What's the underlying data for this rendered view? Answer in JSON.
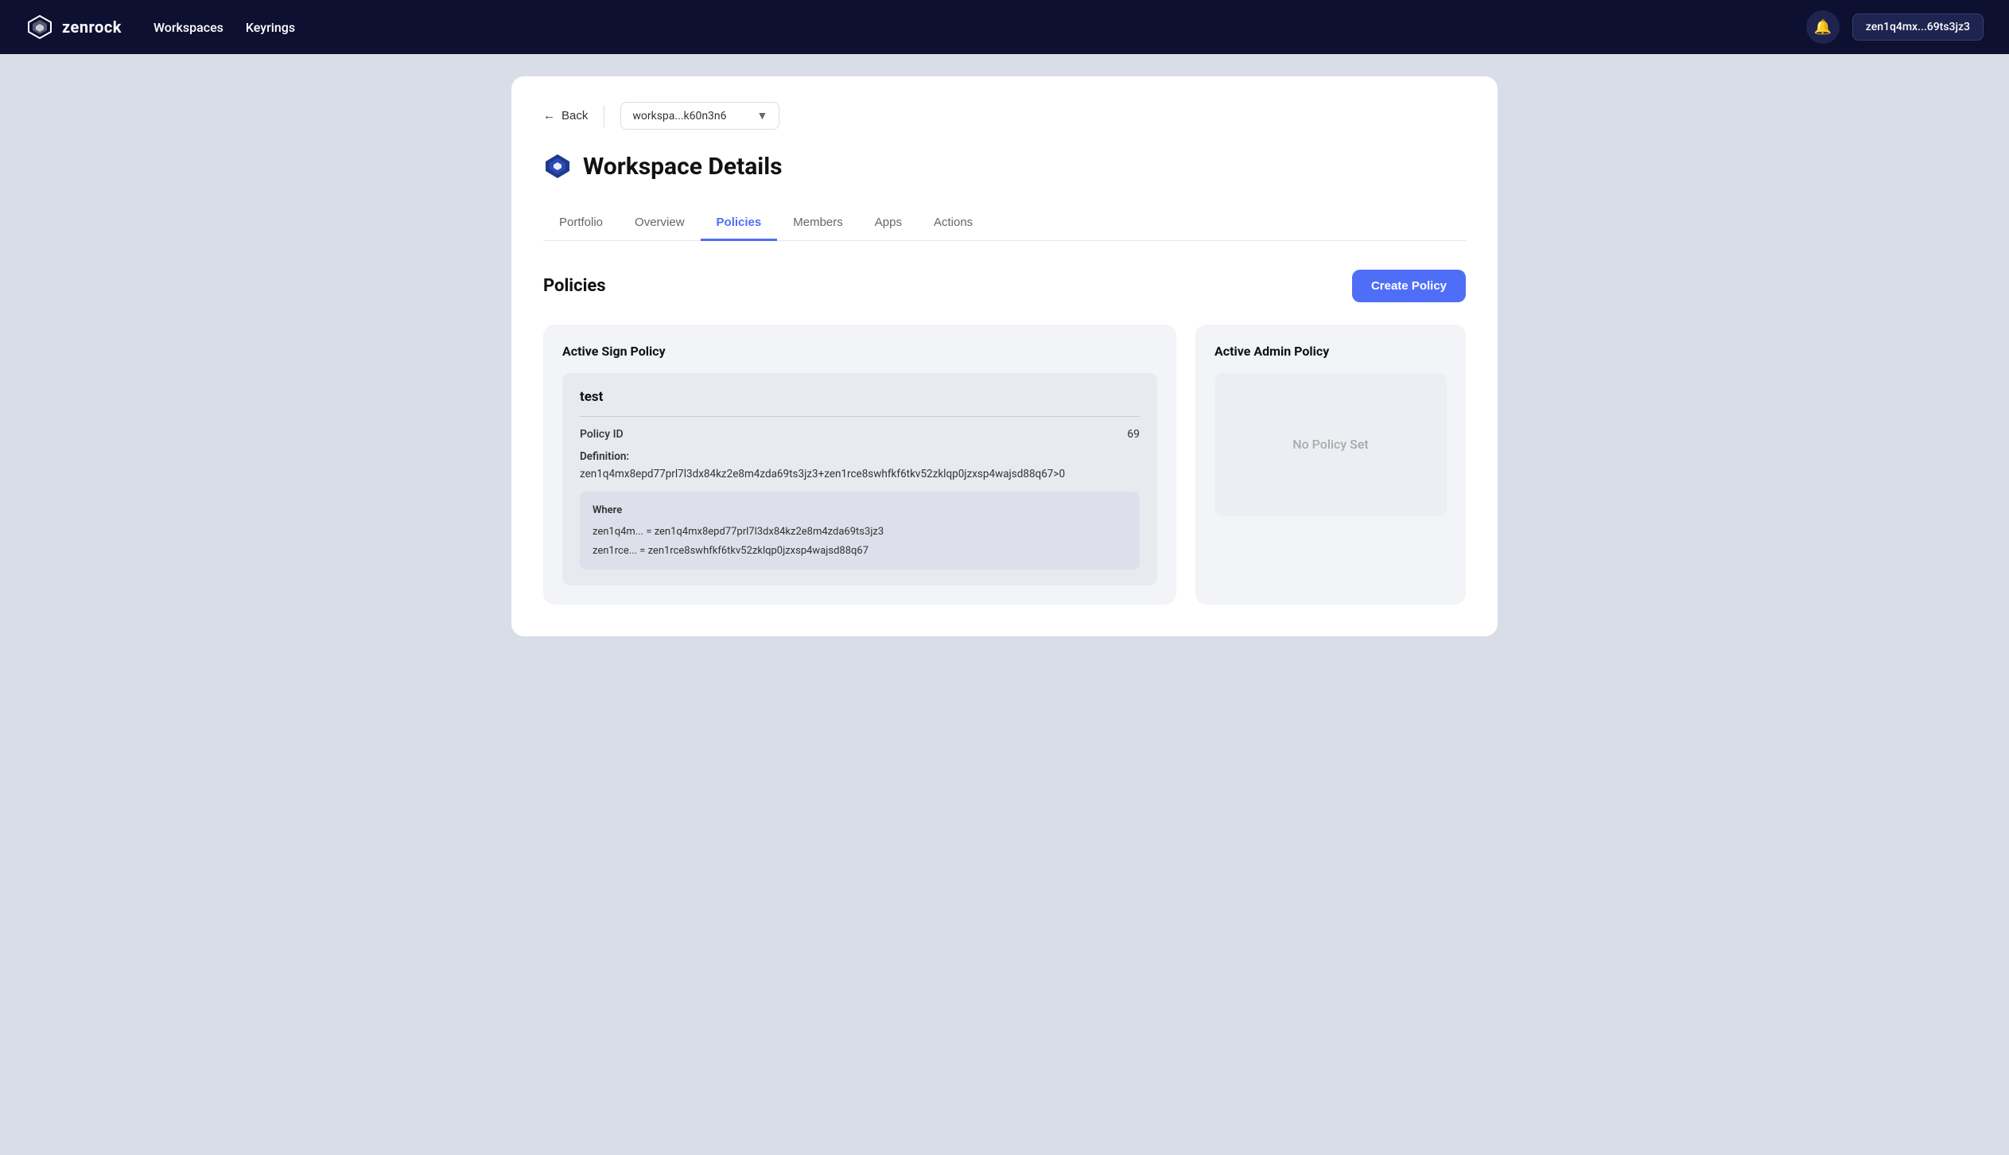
{
  "topnav": {
    "logo_text": "zenrock",
    "nav_links": [
      "Workspaces",
      "Keyrings"
    ],
    "wallet_address": "zen1q4mx...69ts3jz3"
  },
  "back": {
    "label": "Back",
    "workspace_selector": {
      "value": "workspa...k60n3n6"
    }
  },
  "page": {
    "title": "Workspace Details",
    "tabs": [
      {
        "label": "Portfolio",
        "active": false
      },
      {
        "label": "Overview",
        "active": false
      },
      {
        "label": "Policies",
        "active": true
      },
      {
        "label": "Members",
        "active": false
      },
      {
        "label": "Apps",
        "active": false
      },
      {
        "label": "Actions",
        "active": false
      }
    ]
  },
  "policies_section": {
    "title": "Policies",
    "create_button": "Create Policy"
  },
  "active_sign_policy": {
    "panel_title": "Active Sign Policy",
    "card": {
      "name": "test",
      "policy_id_label": "Policy ID",
      "policy_id_value": "69",
      "definition_label": "Definition:",
      "definition_value": "zen1q4mx8epd77prl7l3dx84kz2e8m4zda69ts3jz3+zen1rce8swhfkf6tkv52zklqp0jzxsp4wajsd88q67>0",
      "where_label": "Where",
      "where_items": [
        "zen1q4m... = zen1q4mx8epd77prl7l3dx84kz2e8m4zda69ts3jz3",
        "zen1rce... = zen1rce8swhfkf6tkv52zklqp0jzxsp4wajsd88q67"
      ]
    }
  },
  "active_admin_policy": {
    "panel_title": "Active Admin Policy",
    "no_policy_text": "No Policy Set"
  }
}
